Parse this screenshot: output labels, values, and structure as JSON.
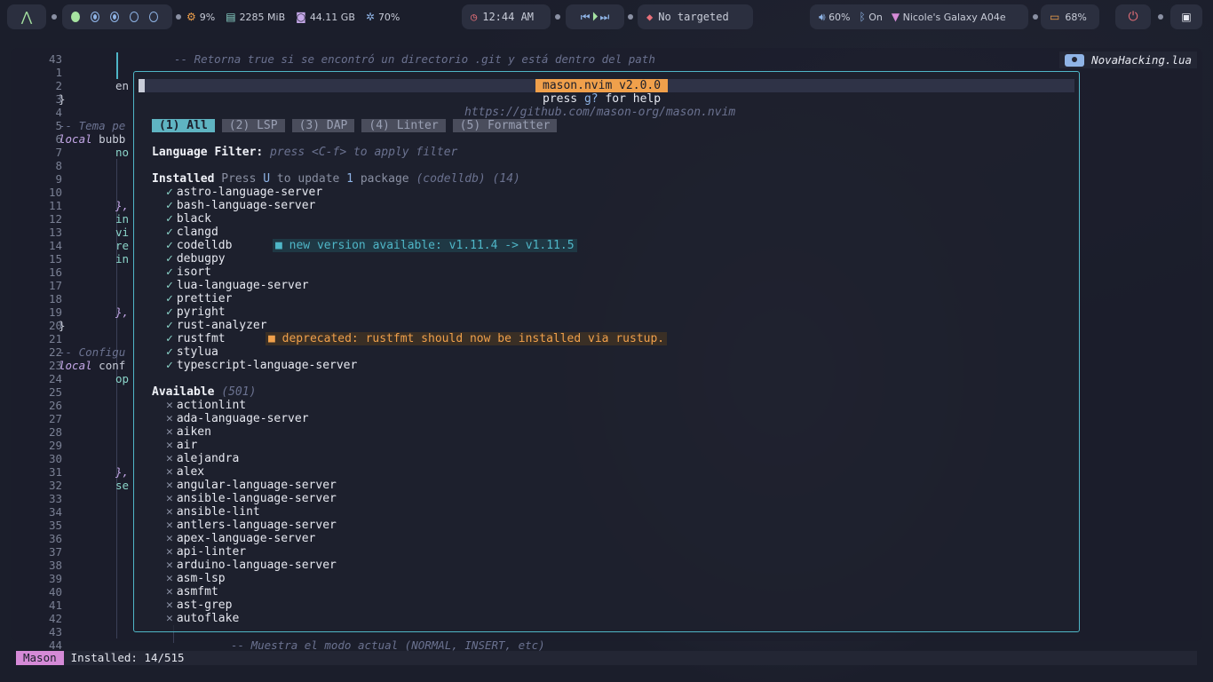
{
  "topbar": {
    "cpu": "9%",
    "ram": "2285 MiB",
    "disk": "44.11 GB",
    "gpu": "70%",
    "clock": "12:44 AM",
    "window": "No targeted",
    "volume": "60%",
    "bluetooth": "On",
    "wifi": "Nicole's Galaxy A04e",
    "battery": "68%"
  },
  "editor": {
    "file_label": "NovaHacking.lua",
    "line_numbers": [
      "43",
      "1",
      "2",
      "3",
      "4",
      "5",
      "6",
      "7",
      "8",
      "9",
      "10",
      "11",
      "12",
      "13",
      "14",
      "15",
      "16",
      "17",
      "18",
      "19",
      "20",
      "21",
      "22",
      "23",
      "24",
      "25",
      "26",
      "27",
      "28",
      "29",
      "30",
      "31",
      "32",
      "33",
      "34",
      "35",
      "36",
      "37",
      "38",
      "39",
      "40",
      "41",
      "42",
      "43",
      "44"
    ],
    "top_comment": "-- Retorna true si se encontró un directorio .git y está dentro del path",
    "bottom_comment": "-- Muestra el modo actual (NORMAL, INSERT, etc)",
    "fragments": {
      "l2": "en",
      "l3": "}",
      "l5": "-- Tema pe",
      "l6a": "local",
      "l6b": " bubb",
      "l7": "no",
      "l11": "},",
      "l12": "in",
      "l13": "vi",
      "l14": "re",
      "l15": "in",
      "l19": "},",
      "l20": "}",
      "l22": "-- Configu",
      "l23a": "local",
      "l23b": " conf",
      "l24": "op",
      "l31": "},",
      "l32": "se"
    }
  },
  "mason": {
    "title": "mason.nvim v2.0.0",
    "help_prefix": "press ",
    "help_key": "g?",
    "help_suffix": " for help",
    "url": "https://github.com/mason-org/mason.nvim",
    "tabs": [
      "(1) All",
      "(2) LSP",
      "(3) DAP",
      "(4) Linter",
      "(5) Formatter"
    ],
    "language_filter_label": "Language Filter:",
    "language_filter_hint": " press <C-f> to apply filter",
    "installed_label": "Installed",
    "installed_press": " Press ",
    "installed_key": "U",
    "installed_mid": " to update ",
    "installed_count_upd": "1",
    "installed_pkg": " package ",
    "installed_detail": "(codelldb) (14)",
    "installed": [
      "astro-language-server",
      "bash-language-server",
      "black",
      "clangd",
      "codelldb",
      "debugpy",
      "isort",
      "lua-language-server",
      "prettier",
      "pyright",
      "rust-analyzer",
      "rustfmt",
      "stylua",
      "typescript-language-server"
    ],
    "codelldb_notice": "■ new version available: v1.11.4 -> v1.11.5",
    "rustfmt_notice": "■ deprecated: rustfmt should now be installed via rustup.",
    "available_label": "Available",
    "available_count": " (501)",
    "available": [
      "actionlint",
      "ada-language-server",
      "aiken",
      "air",
      "alejandra",
      "alex",
      "angular-language-server",
      "ansible-language-server",
      "ansible-lint",
      "antlers-language-server",
      "apex-language-server",
      "api-linter",
      "arduino-language-server",
      "asm-lsp",
      "asmfmt",
      "ast-grep",
      "autoflake"
    ]
  },
  "statusline": {
    "mode": "Mason",
    "info": "Installed: 14/515"
  },
  "colors": {
    "accent": "#4fb6c7",
    "title_bg": "#f0a04b",
    "mode_bg": "#d58ad7"
  }
}
